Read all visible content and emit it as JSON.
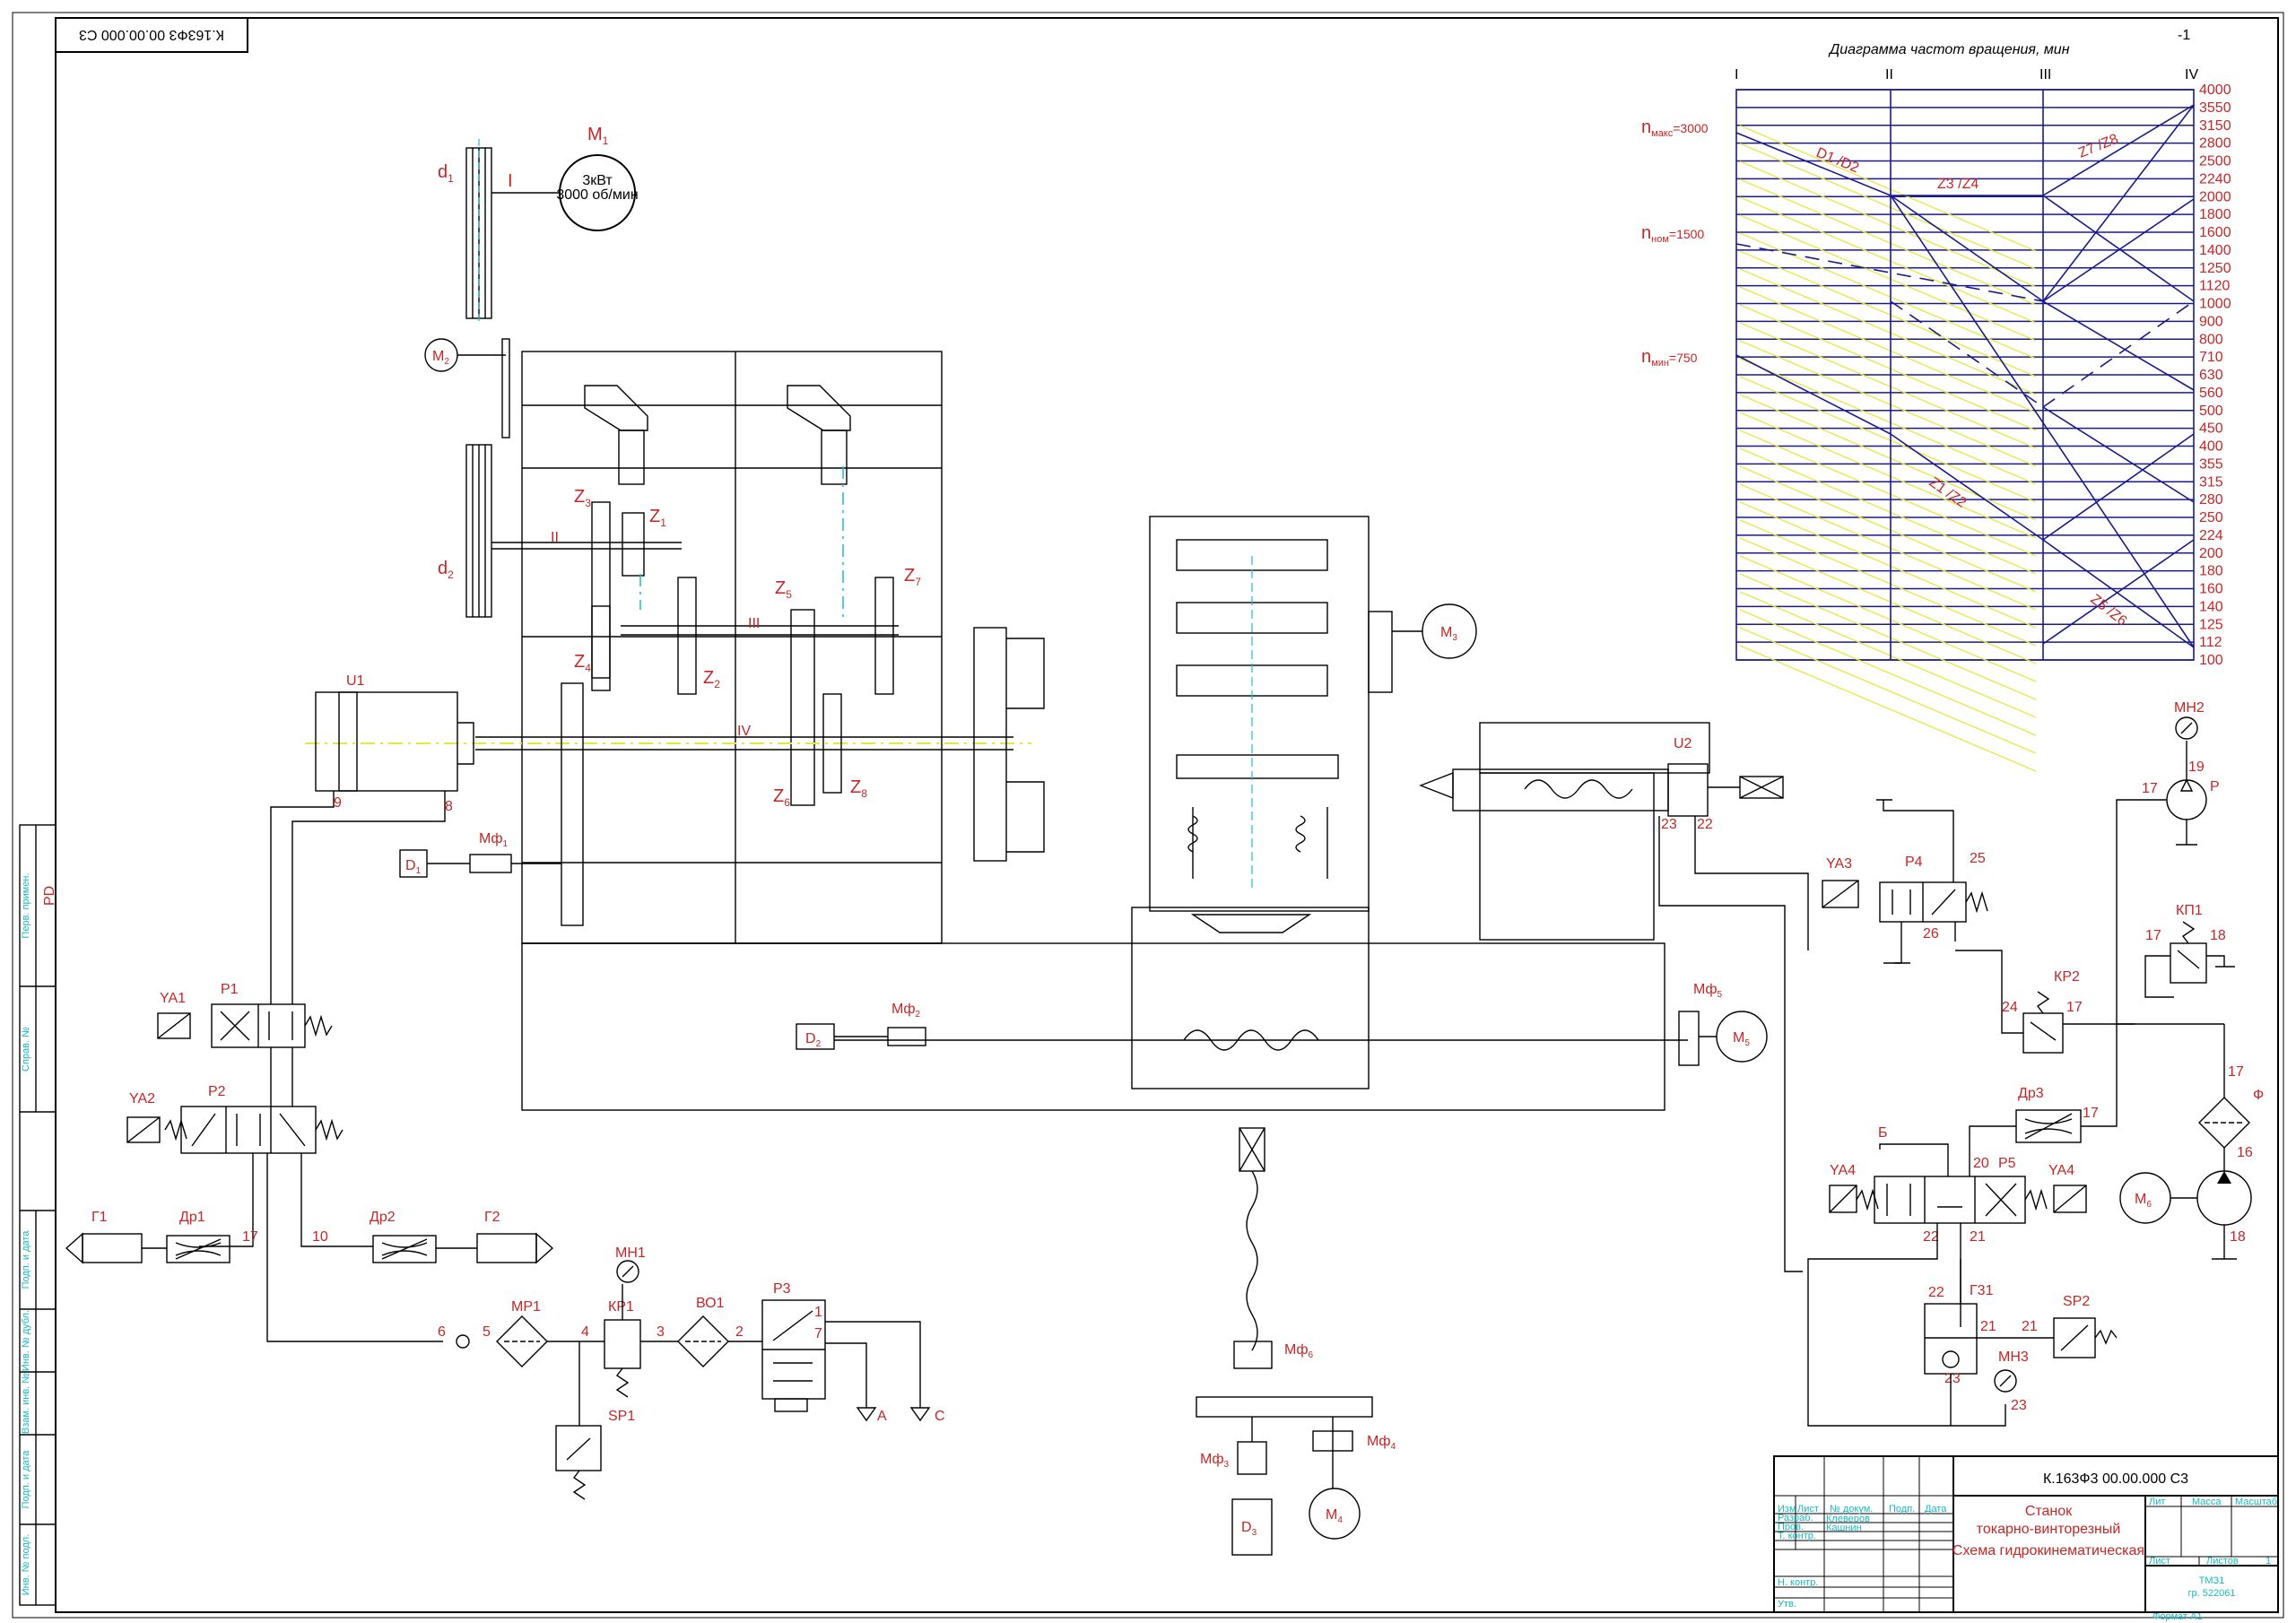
{
  "stamp_top": "К.163Ф3 00.00.000 С3",
  "diagram": {
    "title": "Диаграмма частот вращения,    мин",
    "title_exp": "-1",
    "shafts": [
      "I",
      "II",
      "III",
      "IV"
    ],
    "speeds": [
      "4000",
      "3550",
      "3150",
      "2800",
      "2500",
      "2240",
      "2000",
      "1800",
      "1600",
      "1400",
      "1250",
      "1120",
      "1000",
      "900",
      "800",
      "710",
      "630",
      "560",
      "500",
      "450",
      "400",
      "355",
      "315",
      "280",
      "250",
      "224",
      "200",
      "180",
      "160",
      "140",
      "125",
      "112",
      "100"
    ],
    "n_labels": [
      {
        "n": "n",
        "sub": "макс",
        "val": "=3000"
      },
      {
        "n": "n",
        "sub": "ном",
        "val": "=1500"
      },
      {
        "n": "n",
        "sub": "мин",
        "val": "=750"
      }
    ],
    "ratios": [
      "D1 /D2",
      "Z3 /Z4",
      "Z7 /Z8",
      "Z1 /Z2",
      "Z5 /Z6"
    ]
  },
  "motor_m1": {
    "label": "M",
    "sub": "1",
    "line1": "3кВт",
    "line2": "3000 об/мин"
  },
  "labels": {
    "d1": "d",
    "d1s": "1",
    "d2": "d",
    "d2s": "2",
    "shaft_I": "I",
    "shaft_II": "II",
    "shaft_III": "III",
    "shaft_IV": "IV",
    "z1": "Z",
    "z1s": "1",
    "z2": "Z",
    "z2s": "2",
    "z3": "Z",
    "z3s": "3",
    "z4": "Z",
    "z4s": "4",
    "z5": "Z",
    "z5s": "5",
    "z6": "Z",
    "z6s": "6",
    "z7": "Z",
    "z7s": "7",
    "z8": "Z",
    "z8s": "8",
    "m2": "M",
    "m2s": "2",
    "m3": "M",
    "m3s": "3",
    "m4": "M",
    "m4s": "4",
    "m5": "M",
    "m5s": "5",
    "m6": "M",
    "m6s": "6",
    "u1": "U1",
    "u2": "U2",
    "d1c": "D",
    "d1cs": "1",
    "d2c": "D",
    "d2cs": "2",
    "d3c": "D",
    "d3cs": "3",
    "mf1": "Мф",
    "mf1s": "1",
    "mf2": "Мф",
    "mf2s": "2",
    "mf3": "Мф",
    "mf3s": "3",
    "mf4": "Мф",
    "mf4s": "4",
    "mf5": "Мф",
    "mf5s": "5",
    "mf6": "Мф",
    "mf6s": "6",
    "ya1": "YA1",
    "ya2": "YA2",
    "ya3": "YA3",
    "ya4a": "YA4",
    "ya4b": "YA4",
    "p1": "P1",
    "p2": "P2",
    "p3": "P3",
    "p4": "P4",
    "p5": "P5",
    "g1": "Г1",
    "g2": "Г2",
    "dr1": "Др1",
    "dr2": "Др2",
    "dr3": "Др3",
    "mn1": "МН1",
    "mn2": "МН2",
    "mn3": "МН3",
    "kr1": "КР1",
    "kr2": "КР2",
    "kp1": "КП1",
    "vo1": "ВО1",
    "mp1": "МР1",
    "sp1": "SP1",
    "sp2": "SP2",
    "g31": "Г31",
    "pump_p": "Р",
    "filt_f": "Ф",
    "port_a": "А",
    "port_c": "С",
    "port_b": "Б"
  },
  "port_numbers": [
    "9",
    "8",
    "17",
    "10",
    "6",
    "5",
    "4",
    "3",
    "2",
    "1",
    "7",
    "23",
    "22",
    "25",
    "26",
    "19",
    "17",
    "17",
    "18",
    "24",
    "17",
    "17",
    "20",
    "21",
    "22",
    "21",
    "16",
    "18",
    "22",
    "21",
    "21",
    "23",
    "23"
  ],
  "title_block": {
    "designation": "К.163Ф3 00.00.000 С3",
    "name_line1": "Станок",
    "name_line2": "токарно-винторезный",
    "doc_type": "Схема гидрокинематическая",
    "developer": "Клеверов",
    "checker": "Кашнин",
    "group": "ТМЗ1",
    "group_id": "гр. 522061",
    "format": "Формат А1",
    "sheet_label": "Лист",
    "sheets_label": "Листов",
    "sheets_val": "1",
    "lit_label": "Лит",
    "mass_label": "Масса",
    "scale_label": "Масштаб",
    "rows": [
      "Изм",
      "Лист",
      "№ докум.",
      "Подп.",
      "Дата",
      "Разраб.",
      "Пров.",
      "Т. контр.",
      "Н. контр.",
      "Утв."
    ]
  },
  "side_strip": [
    "Перв. примен.",
    "Справ. №",
    "Подп. и дата",
    "Инв. № дубл.",
    "Взам. инв. №",
    "Подп. и дата",
    "Инв. № подл."
  ]
}
